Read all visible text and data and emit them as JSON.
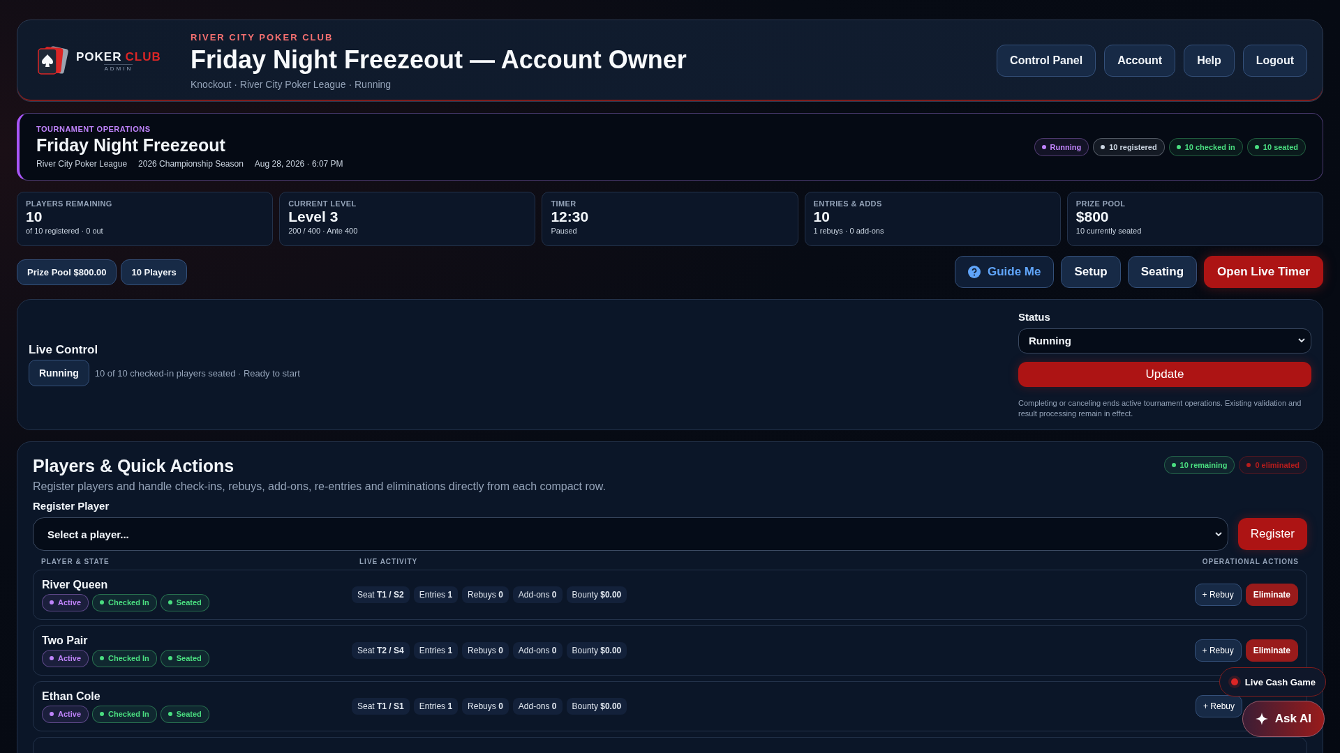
{
  "header": {
    "logo": {
      "word": "POKER",
      "accent": "CLUB",
      "sub": "ADMIN"
    },
    "kicker": "RIVER CITY POKER CLUB",
    "title": "Friday Night Freezeout — Account Owner",
    "subtitle": "Knockout · River City Poker League · Running",
    "nav": [
      "Control Panel",
      "Account",
      "Help",
      "Logout"
    ]
  },
  "operations": {
    "kicker": "TOURNAMENT OPERATIONS",
    "title": "Friday Night Freezeout",
    "meta": [
      "River City Poker League",
      "2026 Championship Season",
      "Aug 28, 2026 · 6:07 PM"
    ],
    "badges": [
      {
        "label": "Running",
        "color": "#c084fc"
      },
      {
        "label": "10 registered",
        "color": "#cbd5e1"
      },
      {
        "label": "10 checked in",
        "color": "#4ade80"
      },
      {
        "label": "10 seated",
        "color": "#4ade80"
      }
    ]
  },
  "stats": [
    {
      "label": "PLAYERS REMAINING",
      "value": "10",
      "note": "of 10 registered · 0 out"
    },
    {
      "label": "CURRENT LEVEL",
      "value": "Level 3",
      "note": "200 / 400 · Ante 400"
    },
    {
      "label": "TIMER",
      "value": "12:30",
      "note": "Paused"
    },
    {
      "label": "ENTRIES & ADDS",
      "value": "10",
      "note": "1 rebuys · 0 add-ons"
    },
    {
      "label": "PRIZE POOL",
      "value": "$800",
      "note": "10 currently seated"
    }
  ],
  "summary_pills": [
    "Prize Pool $800.00",
    "10 Players"
  ],
  "actions": [
    {
      "label": "Guide Me",
      "kind": "guide"
    },
    {
      "label": "Setup",
      "kind": "plain"
    },
    {
      "label": "Seating",
      "kind": "plain"
    },
    {
      "label": "Open Live Timer",
      "kind": "primary"
    }
  ],
  "live_control": {
    "title": "Live Control",
    "state": "Running",
    "note": "10 of 10 checked-in players seated · Ready to start",
    "status_label": "Status",
    "status_value": "Running",
    "update": "Update",
    "help": "Completing or canceling ends active tournament operations. Existing validation and result processing remain in effect."
  },
  "players": {
    "title": "Players & Quick Actions",
    "subtitle": "Register players and handle check-ins, rebuys, add-ons, re-entries and eliminations directly from each compact row.",
    "counts": [
      {
        "label": "10 remaining",
        "color": "#4ade80"
      },
      {
        "label": "0 eliminated",
        "color": "#b91c1c"
      }
    ],
    "register_label": "Register Player",
    "register_placeholder": "Select a player...",
    "register_button": "Register",
    "columns": [
      "PLAYER & STATE",
      "LIVE ACTIVITY",
      "OPERATIONAL ACTIONS"
    ],
    "rows": [
      {
        "name": "River Queen",
        "tags": [
          {
            "label": "Active",
            "color": "#c084fc"
          },
          {
            "label": "Checked In",
            "color": "#4ade80"
          },
          {
            "label": "Seated",
            "color": "#4ade80"
          }
        ],
        "activity": [
          "Seat **T1 / S2**",
          "Entries **1**",
          "Rebuys **0**",
          "Add-ons **0**",
          "Bounty **$0.00**"
        ],
        "buttons": [
          {
            "label": "+ Rebuy",
            "kind": "rebuy"
          },
          {
            "label": "Eliminate",
            "kind": "eliminate"
          }
        ]
      },
      {
        "name": "Two Pair",
        "tags": [
          {
            "label": "Active",
            "color": "#c084fc"
          },
          {
            "label": "Checked In",
            "color": "#4ade80"
          },
          {
            "label": "Seated",
            "color": "#4ade80"
          }
        ],
        "activity": [
          "Seat **T2 / S4**",
          "Entries **1**",
          "Rebuys **0**",
          "Add-ons **0**",
          "Bounty **$0.00**"
        ],
        "buttons": [
          {
            "label": "+ Rebuy",
            "kind": "rebuy"
          },
          {
            "label": "Eliminate",
            "kind": "eliminate"
          }
        ]
      },
      {
        "name": "Ethan Cole",
        "tags": [
          {
            "label": "Active",
            "color": "#c084fc"
          },
          {
            "label": "Checked In",
            "color": "#4ade80"
          },
          {
            "label": "Seated",
            "color": "#4ade80"
          }
        ],
        "activity": [
          "Seat **T1 / S1**",
          "Entries **1**",
          "Rebuys **0**",
          "Add-ons **0**",
          "Bounty **$0.00**"
        ],
        "buttons": [
          {
            "label": "+ Rebuy",
            "kind": "rebuy"
          }
        ]
      }
    ]
  },
  "floating": {
    "live_cash": "Live Cash Game",
    "ask_ai": "Ask AI"
  }
}
